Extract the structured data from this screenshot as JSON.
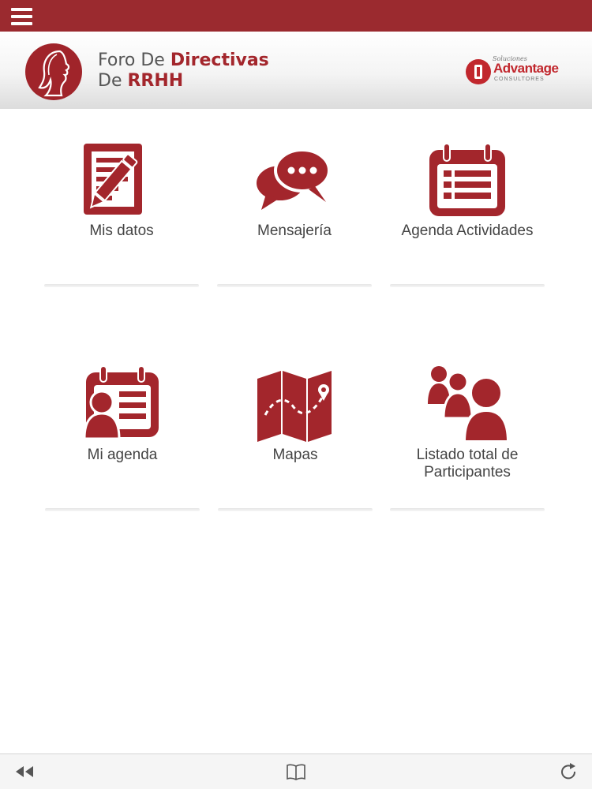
{
  "header": {
    "title_line1_prefix": "Foro De",
    "title_line1_accent": "Directivas",
    "title_line2_prefix": "De",
    "title_line2_accent": "RRHH",
    "brand_small": "Soluciones",
    "brand_name": "Advantage",
    "brand_sub": "CONSULTORES"
  },
  "tiles": [
    {
      "label": "Mis datos",
      "icon": "edit-document-icon"
    },
    {
      "label": "Mensajería",
      "icon": "chat-bubbles-icon"
    },
    {
      "label": "Agenda Actividades",
      "icon": "calendar-icon"
    },
    {
      "label": "Mi agenda",
      "icon": "personal-agenda-icon"
    },
    {
      "label": "Mapas",
      "icon": "map-icon"
    },
    {
      "label": "Listado total de Participantes",
      "icon": "participants-icon"
    }
  ],
  "colors": {
    "primary": "#9b2a2f",
    "icon": "#a3262c",
    "text": "#444444"
  },
  "bottom_bar": {
    "icons": [
      "rewind-icon",
      "book-icon",
      "reload-icon"
    ]
  }
}
